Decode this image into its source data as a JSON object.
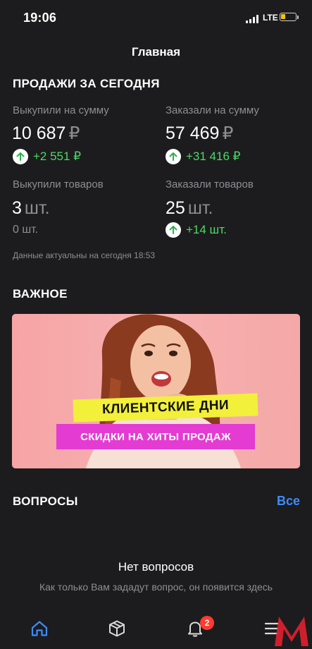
{
  "status_bar": {
    "time": "19:06",
    "network": "LTE"
  },
  "header": {
    "title": "Главная"
  },
  "sales": {
    "title": "ПРОДАЖИ ЗА СЕГОДНЯ",
    "bought_sum_label": "Выкупили на сумму",
    "bought_sum_value": "10 687",
    "bought_sum_unit": "₽",
    "bought_sum_delta": "+2 551 ₽",
    "ordered_sum_label": "Заказали на сумму",
    "ordered_sum_value": "57 469",
    "ordered_sum_unit": "₽",
    "ordered_sum_delta": "+31 416 ₽",
    "bought_items_label": "Выкупили товаров",
    "bought_items_value": "3",
    "bought_items_unit": "шт.",
    "bought_items_delta": "0 шт.",
    "ordered_items_label": "Заказали товаров",
    "ordered_items_value": "25",
    "ordered_items_unit": "шт.",
    "ordered_items_delta": "+14 шт.",
    "updated": "Данные актуальны на сегодня 18:53"
  },
  "important": {
    "title": "ВАЖНОЕ",
    "banner_line1": "КЛИЕНТСКИЕ ДНИ",
    "banner_line2": "СКИДКИ НА ХИТЫ ПРОДАЖ"
  },
  "questions": {
    "title": "ВОПРОСЫ",
    "all_link": "Все",
    "empty_title": "Нет вопросов",
    "empty_subtitle": "Как только Вам зададут вопрос, он появится здесь"
  },
  "tabbar": {
    "items": [
      "home-icon",
      "box-icon",
      "bell-icon",
      "menu-icon"
    ],
    "notifications_badge": "2"
  },
  "colors": {
    "accent": "#3d8bff",
    "positive": "#4cd964",
    "badge": "#ff3b30",
    "background": "#1c1c1e"
  }
}
